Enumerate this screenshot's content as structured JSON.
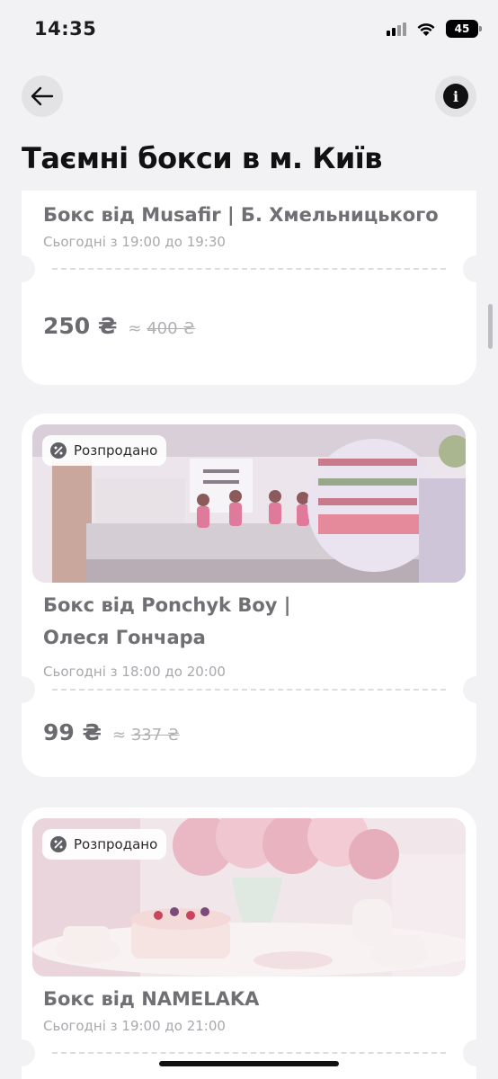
{
  "status_bar": {
    "time": "14:35",
    "battery": "45"
  },
  "header": {
    "title": "Таємні бокси в м. Київ"
  },
  "icons": {
    "back": "arrow-left-icon",
    "info": "info-icon",
    "sold_out": "percent-badge-icon"
  },
  "colors": {
    "card_bg": "#ffffff",
    "page_bg": "#f2f2f4",
    "muted_text": "#6f6f74"
  },
  "boxes": [
    {
      "title_lines": [
        "Бокс від Musafir | Б. Хмельницького"
      ],
      "time": "Сьогодні з 19:00 до 19:30",
      "price": "250 ₴",
      "approx": "≈",
      "old_price": "400 ₴"
    },
    {
      "badge": "Розпродано",
      "title_lines": [
        "Бокс від Ponchyk Boy |",
        "Олеся Гончара"
      ],
      "time": "Сьогодні з 18:00 до 20:00",
      "price": "99 ₴",
      "approx": "≈",
      "old_price": "337 ₴"
    },
    {
      "badge": "Розпродано",
      "title_lines": [
        "Бокс від NAMELAKA"
      ],
      "time": "Сьогодні з 19:00 до 21:00"
    }
  ]
}
